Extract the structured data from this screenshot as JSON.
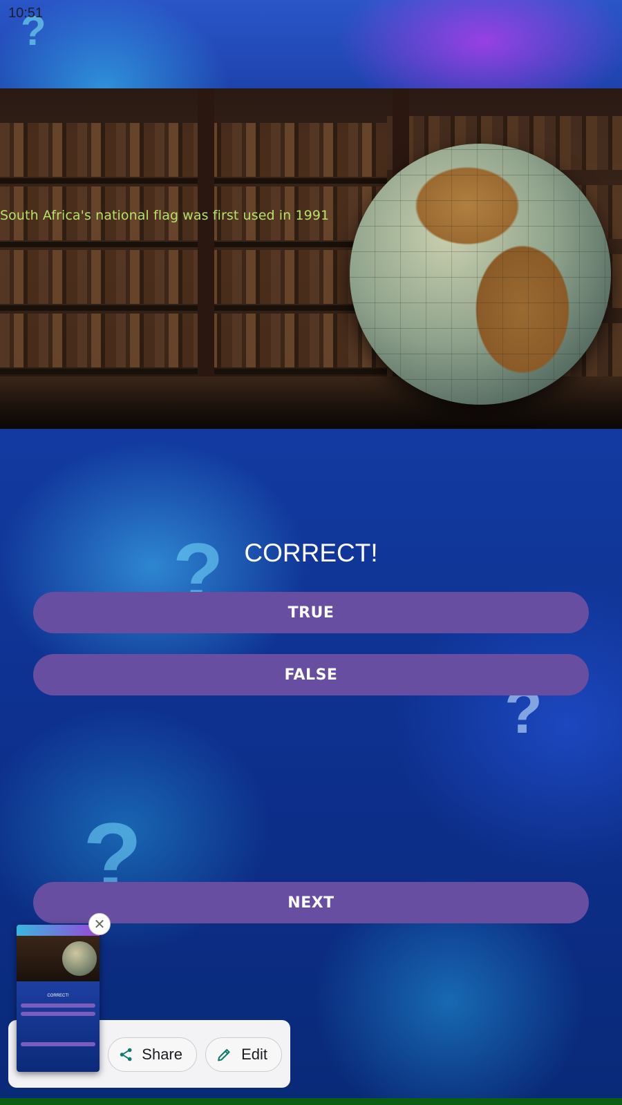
{
  "status_bar": {
    "time": "10:51"
  },
  "quiz": {
    "fact": "South Africa's national flag was first used in 1991",
    "result": "CORRECT!",
    "answers": {
      "true_label": "TRUE",
      "false_label": "FALSE"
    },
    "next_label": "NEXT"
  },
  "screenshot_overlay": {
    "share_label": "Share",
    "edit_label": "Edit",
    "close_icon": "close-icon",
    "thumbnail_result": "CORRECT!"
  },
  "colors": {
    "button": "#674ea0",
    "fact_text": "#b5e26a",
    "icon_teal": "#0e7c6c"
  }
}
